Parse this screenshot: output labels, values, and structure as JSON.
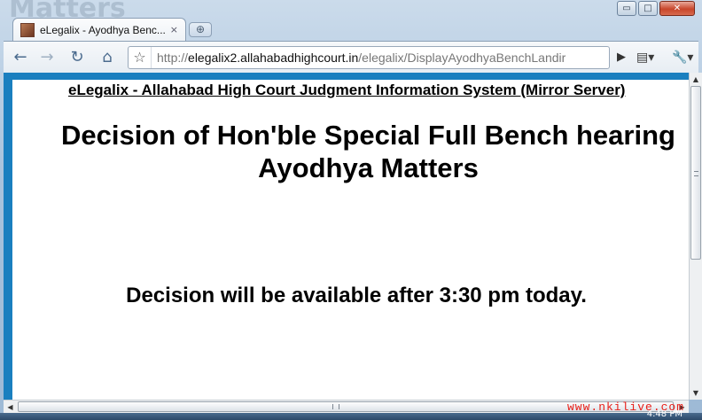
{
  "browser": {
    "background_word": "Matters",
    "window_controls": {
      "minimize": "▭",
      "maximize": "□",
      "close": "✕"
    },
    "tab": {
      "title": "eLegalix - Ayodhya Benc...",
      "close": "×"
    },
    "new_tab": "⊕",
    "toolbar": {
      "back": "←",
      "forward": "→",
      "reload": "↻",
      "home": "⌂",
      "star": "☆",
      "url_scheme": "http://",
      "url_domain": "elegalix2.allahabadhighcourt.in",
      "url_path": "/elegalix/DisplayAyodhyaBenchLandir",
      "go": "▶",
      "page_menu": "▤▾",
      "tools_menu": "🔧▾"
    }
  },
  "page": {
    "header": "eLegalix - Allahabad High Court Judgment Information System (Mirror Server)",
    "title": "Decision of Hon'ble Special Full Bench hearing Ayodhya Matters",
    "availability": "Decision will be available after 3:30 pm today."
  },
  "taskbar": {
    "clock": "4:48 PM"
  },
  "watermark": "www.nkilive.com",
  "colors": {
    "frame_accent": "#1a7fbf",
    "watermark": "#e8201a"
  }
}
